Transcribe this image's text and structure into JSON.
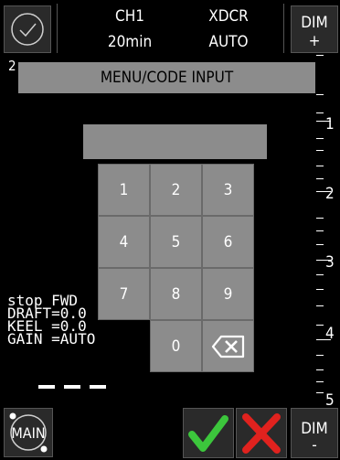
{
  "top_bar": {
    "channel_label": "CH1",
    "range_value": "20min",
    "transducer_label": "XDCR",
    "transducer_mode": "AUTO",
    "dim_up_label": "DIM",
    "dim_up_sign": "+"
  },
  "left_marker": "2",
  "menu_title": "MENU/CODE INPUT",
  "code_value": "",
  "keypad": [
    "1",
    "2",
    "3",
    "4",
    "5",
    "6",
    "7",
    "8",
    "9",
    "0"
  ],
  "scale_labels": [
    "1",
    "2",
    "3",
    "4",
    "5"
  ],
  "status": {
    "line1": "stop FWD",
    "line2": "DRAFT=0.0",
    "line3": "KEEL =0.0",
    "line4": "GAIN =AUTO"
  },
  "bottom_bar": {
    "main_label": "MAIN",
    "dim_down_label": "DIM",
    "dim_down_sign": "-"
  },
  "colors": {
    "confirm": "#3cc63c",
    "cancel": "#e0221e",
    "panel_gray": "#8c8c8c"
  },
  "icons": {
    "status": "check-circle-icon",
    "confirm": "checkmark-icon",
    "cancel": "x-icon",
    "backspace": "backspace-icon"
  }
}
